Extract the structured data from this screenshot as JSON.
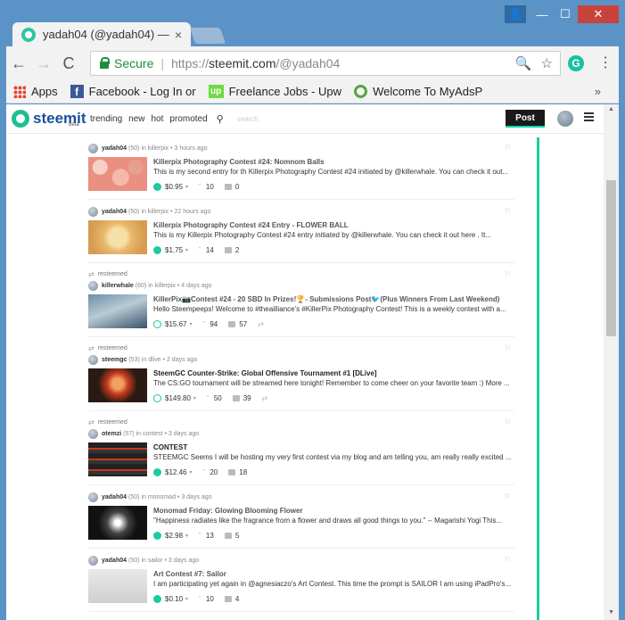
{
  "window": {
    "tab_title": "yadah04 (@yadah04) —",
    "tab_close": "×",
    "controls": {
      "minimize": "—",
      "maximize": "☐",
      "close": "✕",
      "user": "👤"
    }
  },
  "toolbar": {
    "back": "←",
    "forward": "→",
    "reload": "C",
    "secure_label": "Secure",
    "url_prefix": "https://",
    "url_host": "steemit.com",
    "url_path": "/@yadah04",
    "zoom_icon": "🔍",
    "star_icon": "☆",
    "extension_letter": "G",
    "menu": "⋮"
  },
  "bookmarks": {
    "items": [
      {
        "label": "Apps"
      },
      {
        "label": "Facebook - Log In or"
      },
      {
        "label": "Freelance Jobs - Upw"
      },
      {
        "label": "Welcome To MyAdsP"
      }
    ],
    "more": "»",
    "fb_letter": "f",
    "up_letter": "up"
  },
  "site": {
    "logo_text": "steemit",
    "logo_beta": "beta",
    "nav": [
      "trending",
      "new",
      "hot",
      "promoted"
    ],
    "search_placeholder": "search",
    "post_button": "Post",
    "accent_color": "#1fcaa0"
  },
  "feed": [
    {
      "resteemed": "",
      "author": "yadah04",
      "rep": "(50)",
      "category": "in killerpix",
      "time": "• 3 hours ago",
      "title": "Killerpix Photography Contest #24: Nomnom Balls",
      "summary": "This is my second entry for th Killerpix Photography Contest #24 initiated by @killerwhale. You can check it out...",
      "payout": "$0.95",
      "votes": "10",
      "comments": "0"
    },
    {
      "resteemed": "",
      "author": "yadah04",
      "rep": "(50)",
      "category": "in killerpix",
      "time": "• 22 hours ago",
      "title": "Killerpix Photography Contest #24 Entry - FLOWER BALL",
      "summary": "This is my Killerpix Photography Contest #24 entry initiated by @killerwhale. You can check it out here . It...",
      "payout": "$1.75",
      "votes": "14",
      "comments": "2"
    },
    {
      "resteemed": "resteemed",
      "author": "killerwhale",
      "rep": "(60)",
      "category": "in killerpix",
      "time": "• 4 days ago",
      "title": "KillerPix📷Contest #24 - 20 SBD In Prizes!🏆- Submissions Post🐦(Plus Winners From Last Weekend)",
      "summary": "Hello Steempeeps! Welcome to #theailliance's #KillerPix Photography Contest! This is a weekly contest with a...",
      "payout": "$15.67",
      "votes": "94",
      "comments": "57"
    },
    {
      "resteemed": "resteemed",
      "author": "steemgc",
      "rep": "(53)",
      "category": "in dlive",
      "time": "• 2 days ago",
      "title": "SteemGC Counter-Strike: Global Offensive Tournament #1 [DLive]",
      "summary": "The CS:GO tournament will be streamed here tonight! Remember to come cheer on your favorite team :) More ...",
      "payout": "$149.80",
      "votes": "50",
      "comments": "39"
    },
    {
      "resteemed": "resteemed",
      "author": "otemzi",
      "rep": "(57)",
      "category": "in contest",
      "time": "• 3 days ago",
      "title": "CONTEST",
      "summary": "STEEMGC Seems I will be hosting my very first contest via my blog and am telling you, am really really excited ...",
      "payout": "$12.46",
      "votes": "20",
      "comments": "18"
    },
    {
      "resteemed": "",
      "author": "yadah04",
      "rep": "(50)",
      "category": "in monomad",
      "time": "• 3 days ago",
      "title": "Monomad Friday: Glowing Blooming Flower",
      "summary": "\"Happiness radiates like the fragrance from a flower and draws all good things to you.\" -- Magarishi Yogi This...",
      "payout": "$2.98",
      "votes": "13",
      "comments": "5"
    },
    {
      "resteemed": "",
      "author": "yadah04",
      "rep": "(50)",
      "category": "in sailor",
      "time": "• 3 days ago",
      "title": "Art Contest #7: Sailor",
      "summary": "I am participating yet again in @agnesiaczo's Art Contest. This time the prompt is SAILOR I am using iPadPro's...",
      "payout": "$0.10",
      "votes": "10",
      "comments": "4"
    }
  ]
}
